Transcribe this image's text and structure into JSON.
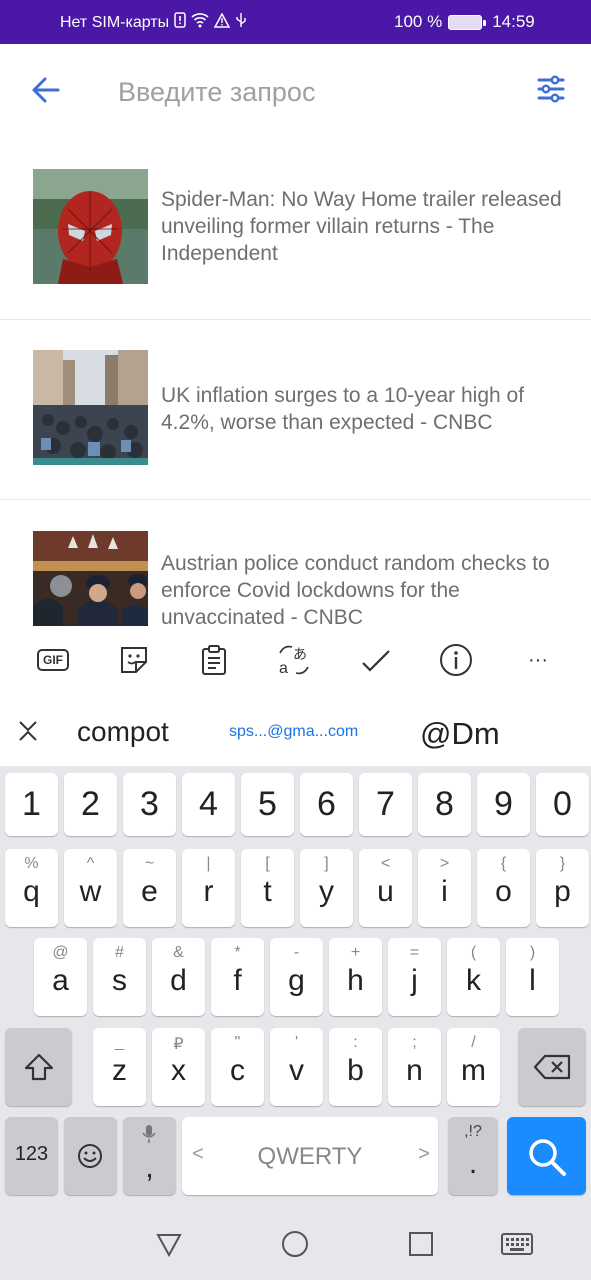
{
  "status_bar": {
    "carrier": "Нет SIM-карты",
    "battery": "100 %",
    "time": "14:59"
  },
  "search": {
    "placeholder": "Введите запрос"
  },
  "news": [
    {
      "title": "Spider-Man: No Way Home trailer released unveiling former villain returns - The Independent",
      "image": "spider-man-image"
    },
    {
      "title": "UK inflation surges to a 10-year high of 4.2%, worse than expected - CNBC",
      "image": "crowded-street-image"
    },
    {
      "title": "Austrian police conduct random checks to enforce Covid lockdowns for the unvaccinated - CNBC",
      "image": "police-check-image"
    }
  ],
  "keyboard_toolbar": {
    "gif": "GIF",
    "more": "···"
  },
  "suggestions": {
    "word": "compot",
    "email": "sps...@gma...com",
    "handle": "@Dm"
  },
  "keyboard": {
    "numbers": [
      "1",
      "2",
      "3",
      "4",
      "5",
      "6",
      "7",
      "8",
      "9",
      "0"
    ],
    "row1": [
      {
        "k": "q",
        "s": "%"
      },
      {
        "k": "w",
        "s": "^"
      },
      {
        "k": "e",
        "s": "~"
      },
      {
        "k": "r",
        "s": "|"
      },
      {
        "k": "t",
        "s": "["
      },
      {
        "k": "y",
        "s": "]"
      },
      {
        "k": "u",
        "s": "<"
      },
      {
        "k": "i",
        "s": ">"
      },
      {
        "k": "o",
        "s": "{"
      },
      {
        "k": "p",
        "s": "}"
      }
    ],
    "row2": [
      {
        "k": "a",
        "s": "@"
      },
      {
        "k": "s",
        "s": "#"
      },
      {
        "k": "d",
        "s": "&"
      },
      {
        "k": "f",
        "s": "*"
      },
      {
        "k": "g",
        "s": "-"
      },
      {
        "k": "h",
        "s": "+"
      },
      {
        "k": "j",
        "s": "="
      },
      {
        "k": "k",
        "s": "("
      },
      {
        "k": "l",
        "s": ")"
      }
    ],
    "row3": [
      {
        "k": "z",
        "s": "_"
      },
      {
        "k": "x",
        "s": "₽"
      },
      {
        "k": "c",
        "s": "\""
      },
      {
        "k": "v",
        "s": "'"
      },
      {
        "k": "b",
        "s": ":"
      },
      {
        "k": "n",
        "s": ";"
      },
      {
        "k": "m",
        "s": "/"
      }
    ],
    "mode_key": "123",
    "comma_key": ",",
    "space_label": "QWERTY",
    "space_left": "<",
    "space_right": ">",
    "punct_top": ",!?",
    "punct_main": "."
  },
  "colors": {
    "status_bar": "#4a17a6",
    "accent": "#1a73e8",
    "search_key": "#1a8cff"
  }
}
